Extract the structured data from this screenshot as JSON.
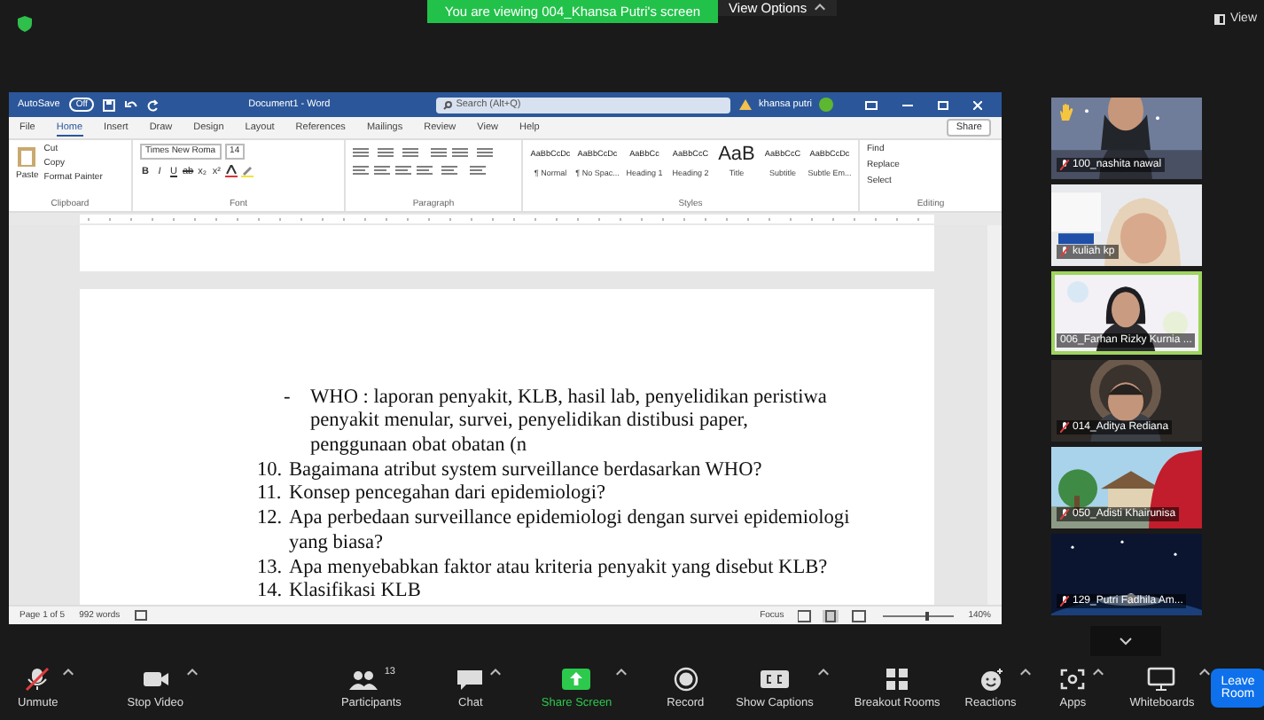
{
  "top_bar": {
    "banner": "You are viewing 004_Khansa Putri's screen",
    "view_options": "View Options",
    "view": "View"
  },
  "word": {
    "title_bar": {
      "autosave": "AutoSave",
      "autosave_state": "Off",
      "document_title": "Document1 - Word",
      "search_placeholder": "Search (Alt+Q)",
      "user": "khansa putri"
    },
    "tabs": [
      {
        "label": "File",
        "selected": false
      },
      {
        "label": "Home",
        "selected": true
      },
      {
        "label": "Insert",
        "selected": false
      },
      {
        "label": "Draw",
        "selected": false
      },
      {
        "label": "Design",
        "selected": false
      },
      {
        "label": "Layout",
        "selected": false
      },
      {
        "label": "References",
        "selected": false
      },
      {
        "label": "Mailings",
        "selected": false
      },
      {
        "label": "Review",
        "selected": false
      },
      {
        "label": "View",
        "selected": false
      },
      {
        "label": "Help",
        "selected": false
      }
    ],
    "share": "Share",
    "clipboard": {
      "paste": "Paste",
      "cut": "Cut",
      "copy": "Copy",
      "format_painter": "Format Painter",
      "label": "Clipboard"
    },
    "font": {
      "name": "Times New Roma",
      "size": "14",
      "buttons": [
        "B",
        "I",
        "U",
        "ab",
        "x₂",
        "x²"
      ],
      "label": "Font"
    },
    "paragraph": {
      "label": "Paragraph"
    },
    "styles": {
      "items": [
        {
          "preview": "AaBbCcDc",
          "name": "¶ Normal"
        },
        {
          "preview": "AaBbCcDc",
          "name": "¶ No Spac..."
        },
        {
          "preview": "AaBbCc",
          "name": "Heading 1"
        },
        {
          "preview": "AaBbCcC",
          "name": "Heading 2"
        },
        {
          "preview": "AaB",
          "name": "Title"
        },
        {
          "preview": "AaBbCcC",
          "name": "Subtitle"
        },
        {
          "preview": "AaBbCcDc",
          "name": "Subtle Em..."
        }
      ],
      "label": "Styles"
    },
    "editing": {
      "find": "Find",
      "replace": "Replace",
      "select": "Select",
      "label": "Editing"
    },
    "document": [
      {
        "kind": "bullet",
        "marker": "-",
        "text": "WHO : laporan penyakit, KLB, hasil lab, penyelidikan peristiwa penyakit menular, survei, penyelidikan distibusi paper, penggunaan obat obatan (n"
      },
      {
        "kind": "numbered",
        "marker": "10.",
        "text": "Bagaimana atribut system surveillance berdasarkan WHO?"
      },
      {
        "kind": "numbered",
        "marker": "11.",
        "text": "Konsep pencegahan dari epidemiologi?"
      },
      {
        "kind": "numbered",
        "marker": "12.",
        "text": "Apa perbedaan surveillance epidemiologi dengan survei epidemiologi yang biasa?"
      },
      {
        "kind": "numbered",
        "marker": "13.",
        "text": "Apa menyebabkan faktor atau kriteria penyakit yang disebut KLB?"
      },
      {
        "kind": "numbered",
        "marker": "14.",
        "text": "Klasifikasi KLB"
      }
    ],
    "status_bar": {
      "page": "Page 1 of 5",
      "words": "992 words",
      "focus": "Focus",
      "zoom": "140%",
      "level": 0.6
    }
  },
  "participants": [
    {
      "name": "100_nashita nawal",
      "muted": true,
      "active": false,
      "hand_raised": true
    },
    {
      "name": "kuliah kp",
      "muted": true,
      "active": false,
      "hand_raised": false
    },
    {
      "name": "006_Farhan Rizky Kurnia ...",
      "muted": false,
      "active": true,
      "hand_raised": false
    },
    {
      "name": "014_Aditya Rediana",
      "muted": true,
      "active": false,
      "hand_raised": false
    },
    {
      "name": "050_Adisti Khairunisa",
      "muted": true,
      "active": false,
      "hand_raised": false
    },
    {
      "name": "129_Putri Fadhila Am...",
      "muted": true,
      "active": false,
      "hand_raised": false
    }
  ],
  "toolbar": [
    {
      "kind": "mic",
      "label": "Unmute",
      "caret": true
    },
    {
      "kind": "video",
      "label": "Stop Video",
      "caret": true
    },
    {
      "kind": "participants",
      "label": "Participants",
      "count": "13",
      "caret": false
    },
    {
      "kind": "chat",
      "label": "Chat",
      "caret": true
    },
    {
      "kind": "share",
      "label": "Share Screen",
      "caret": true
    },
    {
      "kind": "record",
      "label": "Record",
      "caret": false
    },
    {
      "kind": "captions",
      "label": "Show Captions",
      "caret": true
    },
    {
      "kind": "breakout",
      "label": "Breakout Rooms",
      "caret": false
    },
    {
      "kind": "reactions",
      "label": "Reactions",
      "caret": true
    },
    {
      "kind": "apps",
      "label": "Apps",
      "caret": true
    },
    {
      "kind": "whiteboard",
      "label": "Whiteboards",
      "caret": true
    }
  ],
  "leave": "Leave Room"
}
